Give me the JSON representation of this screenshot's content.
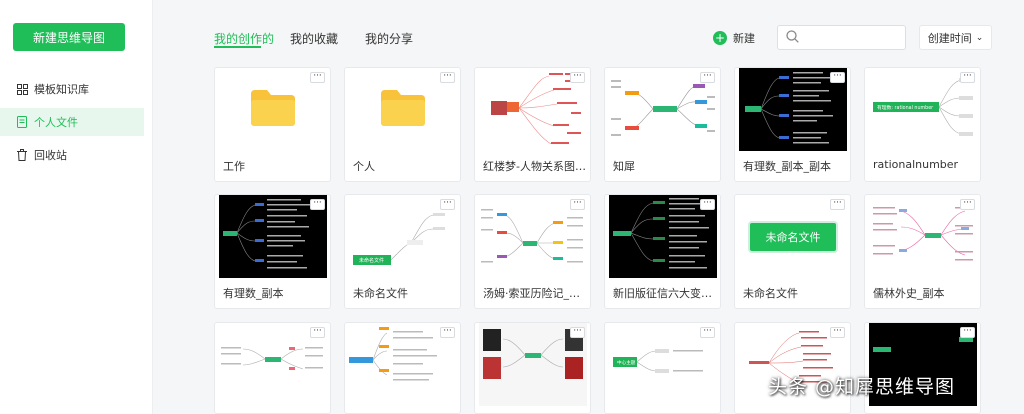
{
  "sidebar": {
    "new_button": "新建思维导图",
    "items": [
      {
        "label": "模板知识库",
        "icon": "grid-icon"
      },
      {
        "label": "个人文件",
        "icon": "file-icon"
      },
      {
        "label": "回收站",
        "icon": "trash-icon"
      }
    ],
    "active_index": 1
  },
  "header": {
    "tabs": [
      "我的创作的",
      "我的收藏",
      "我的分享"
    ],
    "active_tab": 0,
    "new_label": "新建",
    "search": {
      "value": "",
      "placeholder": ""
    },
    "sort_label": "创建时间"
  },
  "cards": [
    {
      "title": "工作",
      "type": "folder"
    },
    {
      "title": "个人",
      "type": "folder"
    },
    {
      "title": "红楼梦-人物关系图_...",
      "type": "mindmap"
    },
    {
      "title": "知犀",
      "type": "mindmap"
    },
    {
      "title": "有理数_副本_副本",
      "type": "mindmap-dark"
    },
    {
      "title": "rationalnumber",
      "type": "mindmap"
    },
    {
      "title": "有理数_副本",
      "type": "mindmap-dark"
    },
    {
      "title": "未命名文件",
      "type": "mindmap"
    },
    {
      "title": "汤姆·索亚历险记_副本",
      "type": "mindmap"
    },
    {
      "title": "新旧版征信六大变化...",
      "type": "mindmap-dark"
    },
    {
      "title": "未命名文件",
      "type": "mindmap"
    },
    {
      "title": "儒林外史_副本",
      "type": "mindmap"
    },
    {
      "title": "",
      "type": "mindmap"
    },
    {
      "title": "",
      "type": "mindmap"
    },
    {
      "title": "",
      "type": "mindmap"
    },
    {
      "title": "",
      "type": "mindmap"
    },
    {
      "title": "",
      "type": "mindmap"
    },
    {
      "title": "",
      "type": "mindmap-dark"
    }
  ],
  "thumb_labels": {
    "rational": "有理数:  rational number",
    "untitled_small": "未命名文件",
    "untitled_big": "未命名文件",
    "center_topic": "中心主题"
  },
  "more_label": "···",
  "watermark": "头条 @知犀思维导图",
  "colors": {
    "brand": "#1fbe58",
    "folder": "#f8c33a"
  }
}
